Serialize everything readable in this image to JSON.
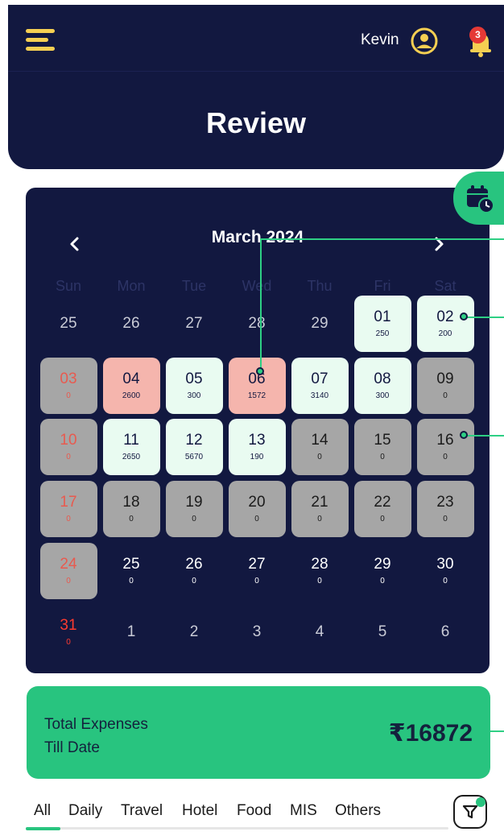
{
  "header": {
    "user_name": "Kevin",
    "notification_count": "3",
    "title": "Review",
    "icons": [
      "menu-icon",
      "user-icon",
      "bell-icon"
    ]
  },
  "calendar": {
    "month_label": "March 2024",
    "weekdays": [
      "Sun",
      "Mon",
      "Tue",
      "Wed",
      "Thu",
      "Fri",
      "Sat"
    ],
    "cells": [
      {
        "day": "25",
        "amount": "",
        "state": "other"
      },
      {
        "day": "26",
        "amount": "",
        "state": "other"
      },
      {
        "day": "27",
        "amount": "",
        "state": "other"
      },
      {
        "day": "28",
        "amount": "",
        "state": "other"
      },
      {
        "day": "29",
        "amount": "",
        "state": "other"
      },
      {
        "day": "01",
        "amount": "250",
        "state": "green"
      },
      {
        "day": "02",
        "amount": "200",
        "state": "green"
      },
      {
        "day": "03",
        "amount": "0",
        "state": "gray",
        "sunday": true
      },
      {
        "day": "04",
        "amount": "2600",
        "state": "red"
      },
      {
        "day": "05",
        "amount": "300",
        "state": "green"
      },
      {
        "day": "06",
        "amount": "1572",
        "state": "red"
      },
      {
        "day": "07",
        "amount": "3140",
        "state": "green"
      },
      {
        "day": "08",
        "amount": "300",
        "state": "green"
      },
      {
        "day": "09",
        "amount": "0",
        "state": "gray"
      },
      {
        "day": "10",
        "amount": "0",
        "state": "gray",
        "sunday": true
      },
      {
        "day": "11",
        "amount": "2650",
        "state": "green"
      },
      {
        "day": "12",
        "amount": "5670",
        "state": "green"
      },
      {
        "day": "13",
        "amount": "190",
        "state": "green"
      },
      {
        "day": "14",
        "amount": "0",
        "state": "gray"
      },
      {
        "day": "15",
        "amount": "0",
        "state": "gray"
      },
      {
        "day": "16",
        "amount": "0",
        "state": "gray"
      },
      {
        "day": "17",
        "amount": "0",
        "state": "gray",
        "sunday": true
      },
      {
        "day": "18",
        "amount": "0",
        "state": "gray"
      },
      {
        "day": "19",
        "amount": "0",
        "state": "gray"
      },
      {
        "day": "20",
        "amount": "0",
        "state": "gray"
      },
      {
        "day": "21",
        "amount": "0",
        "state": "gray"
      },
      {
        "day": "22",
        "amount": "0",
        "state": "gray"
      },
      {
        "day": "23",
        "amount": "0",
        "state": "gray"
      },
      {
        "day": "24",
        "amount": "0",
        "state": "gray",
        "sunday": true
      },
      {
        "day": "25",
        "amount": "0",
        "state": "plain"
      },
      {
        "day": "26",
        "amount": "0",
        "state": "plain"
      },
      {
        "day": "27",
        "amount": "0",
        "state": "plain"
      },
      {
        "day": "28",
        "amount": "0",
        "state": "plain"
      },
      {
        "day": "29",
        "amount": "0",
        "state": "plain"
      },
      {
        "day": "30",
        "amount": "0",
        "state": "plain"
      },
      {
        "day": "31",
        "amount": "0",
        "state": "plain",
        "sunday": true
      },
      {
        "day": "1",
        "amount": "",
        "state": "other"
      },
      {
        "day": "2",
        "amount": "",
        "state": "other"
      },
      {
        "day": "3",
        "amount": "",
        "state": "other"
      },
      {
        "day": "4",
        "amount": "",
        "state": "other"
      },
      {
        "day": "5",
        "amount": "",
        "state": "other"
      },
      {
        "day": "6",
        "amount": "",
        "state": "other"
      }
    ]
  },
  "summary": {
    "label_line1": "Total Expenses",
    "label_line2": "Till Date",
    "amount": "₹16872"
  },
  "tabs": [
    {
      "label": "All",
      "active": true
    },
    {
      "label": "Daily"
    },
    {
      "label": "Travel"
    },
    {
      "label": "Hotel"
    },
    {
      "label": "Food"
    },
    {
      "label": "MIS"
    },
    {
      "label": "Others"
    }
  ],
  "colors": {
    "navy": "#121840",
    "accent_green": "#28c47f",
    "cell_green": "#e9fbf1",
    "cell_red": "#f5b5ad",
    "cell_gray": "#a6a6a6",
    "sunday_red": "#ff3b2f",
    "menu_yellow": "#f5cf52"
  }
}
